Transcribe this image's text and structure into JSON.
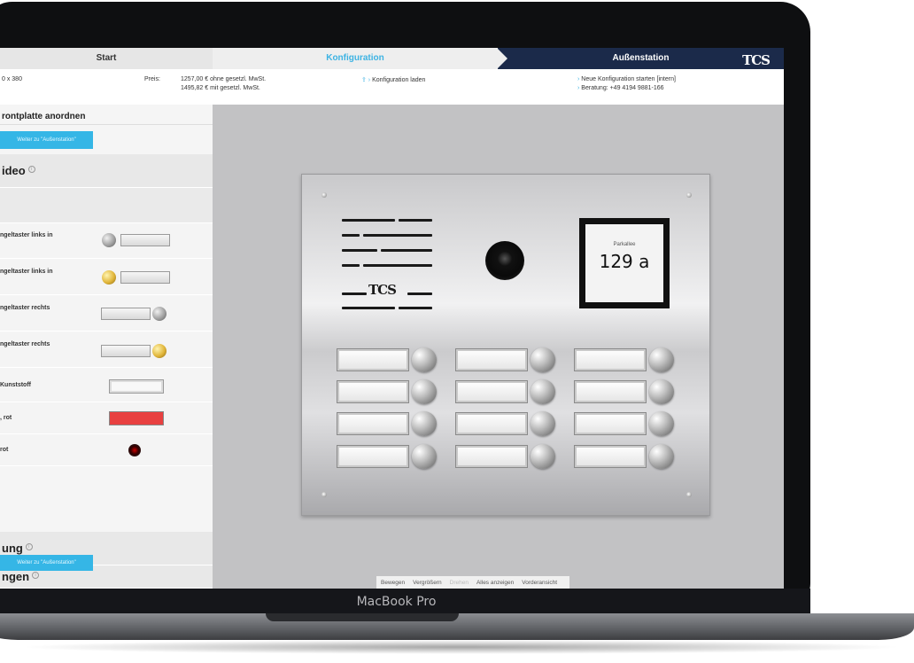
{
  "steps": {
    "start": "Start",
    "config": "Konfiguration",
    "outdoor": "Außenstation",
    "logo": "TCS"
  },
  "info": {
    "size": "0 x 380",
    "price_label": "Preis:",
    "price_net": "1257,00 € ohne gesetzl. MwSt.",
    "price_gross": "1495,82 € mit gesetzl. MwSt.",
    "load_config": "Konfiguration laden",
    "new_config": "Neue Konfiguration starten [intern]",
    "advice": "Beratung: +49 4194 9881-166"
  },
  "sidebar": {
    "heading": "rontplatte anordnen",
    "next_button_top": "Weiter zu \"Außenstation\"",
    "section_video": "ideo",
    "rows": [
      {
        "label": "ngeltaster links in"
      },
      {
        "label": "ngeltaster links in"
      },
      {
        "label": "ngeltaster rechts"
      },
      {
        "label": "ngeltaster rechts"
      },
      {
        "label": "Kunststoff"
      },
      {
        "label": ", rot"
      },
      {
        "label": "rot"
      }
    ],
    "section_a": "ung",
    "section_b": "ngen",
    "next_button_bottom": "Weiter zu \"Außenstation\""
  },
  "preview": {
    "logo": "TCS",
    "display_label": "Parkallee",
    "display_value": "129 a"
  },
  "toolbar": [
    "Bewegen",
    "Vergrößern",
    "Drehen",
    "Alles anzeigen",
    "Vorderansicht"
  ],
  "laptop": {
    "model": "MacBook Pro"
  },
  "colors": {
    "accent": "#35b6e6",
    "navy": "#1b2a4a",
    "screen_bg": "#c2c2c4"
  }
}
